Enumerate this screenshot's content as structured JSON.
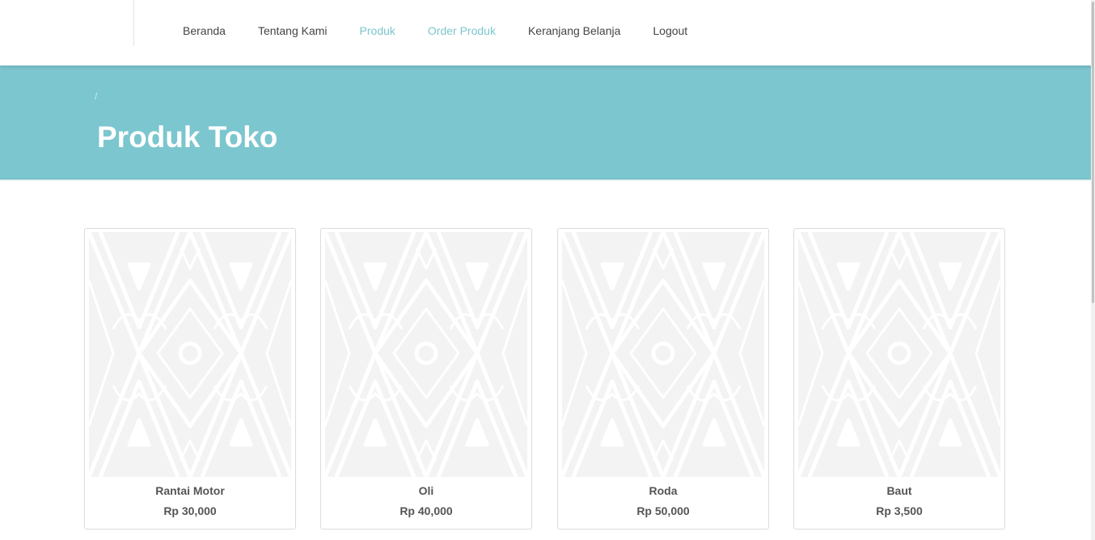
{
  "nav": {
    "items": [
      {
        "label": "Beranda",
        "active": false
      },
      {
        "label": "Tentang Kami",
        "active": false
      },
      {
        "label": "Produk",
        "active": true
      },
      {
        "label": "Order Produk",
        "active": true
      },
      {
        "label": "Keranjang Belanja",
        "active": false
      },
      {
        "label": "Logout",
        "active": false
      }
    ]
  },
  "hero": {
    "breadcrumb_separator": "/",
    "title": "Produk Toko",
    "background_color": "#7cc6cf"
  },
  "products": [
    {
      "name": "Rantai Motor",
      "price": "Rp 30,000"
    },
    {
      "name": "Oli",
      "price": "Rp 40,000"
    },
    {
      "name": "Roda",
      "price": "Rp 50,000"
    },
    {
      "name": "Baut",
      "price": "Rp 3,500"
    }
  ],
  "colors": {
    "accent": "#7cc6ce",
    "nav_text": "#444444",
    "card_text": "#555555"
  }
}
